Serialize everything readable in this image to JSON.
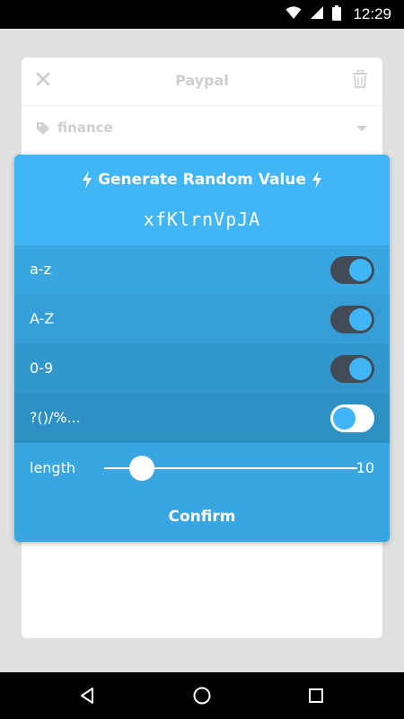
{
  "status_bar": {
    "time": "12:29"
  },
  "background_card": {
    "title": "Paypal",
    "tag": "finance"
  },
  "dialog": {
    "title": "Generate Random Value",
    "generated_value": "xfKlrnVpJA",
    "options": [
      {
        "label": "a-z",
        "enabled": true,
        "row_color": "#3aa6e0"
      },
      {
        "label": "A-Z",
        "enabled": true,
        "row_color": "#369ed6"
      },
      {
        "label": "0-9",
        "enabled": true,
        "row_color": "#3297cd"
      },
      {
        "label": "?()/%...",
        "enabled": false,
        "row_color": "#2e8fc3"
      }
    ],
    "length": {
      "label": "length",
      "value": "10",
      "slider_fraction": 0.15,
      "row_color": "#3aa6e0"
    },
    "confirm_label": "Confirm"
  },
  "colors": {
    "accent": "#40b6f6",
    "toggle_on_track": "#434c56",
    "confirm_bg": "#3aa6e0"
  }
}
